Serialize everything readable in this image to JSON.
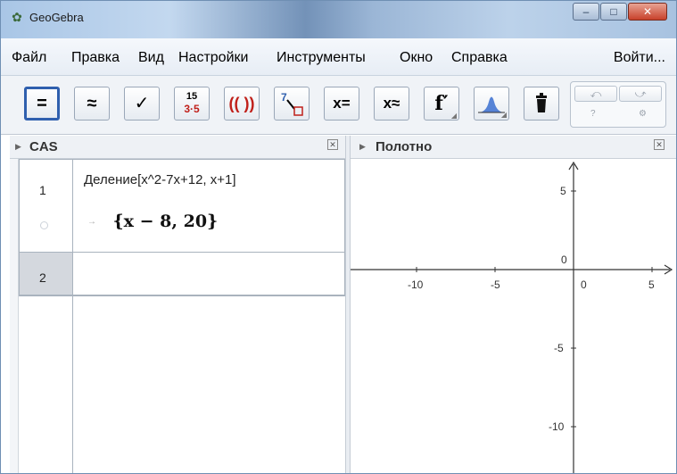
{
  "window": {
    "title": "GeoGebra",
    "buttons": {
      "minimize": "–",
      "maximize": "□",
      "close": "✕"
    }
  },
  "menu": {
    "items": [
      "Файл",
      "Правка",
      "Вид",
      "Настройки",
      "Инструменты",
      "Окно",
      "Справка"
    ],
    "login": "Войти..."
  },
  "toolbar": {
    "tools": [
      {
        "name": "evaluate",
        "label": "=",
        "active": true
      },
      {
        "name": "numeric",
        "label": "≈"
      },
      {
        "name": "keep-input",
        "label": "✓"
      },
      {
        "name": "factor",
        "label_top": "15",
        "label_bottom": "3·5"
      },
      {
        "name": "expand",
        "label": "(( ))"
      },
      {
        "name": "substitute",
        "label": "7"
      },
      {
        "name": "solve",
        "label": "x="
      },
      {
        "name": "solve-numerically",
        "label": "x≈"
      },
      {
        "name": "derivative",
        "label": "f′"
      },
      {
        "name": "probability",
        "label": ""
      },
      {
        "name": "delete",
        "label": ""
      }
    ]
  },
  "cas": {
    "title": "CAS",
    "rows": [
      {
        "number": "1",
        "input": "Деление[x^2-7x+12, x+1]",
        "output": "{x − 8, 20}"
      },
      {
        "number": "2",
        "input": "",
        "output": ""
      }
    ]
  },
  "graphics": {
    "title": "Полотно",
    "x_ticks": [
      "-10",
      "-5",
      "0",
      "5"
    ],
    "y_ticks": [
      "5",
      "0",
      "-5",
      "-10"
    ]
  },
  "colors": {
    "accent": "#2f5fae",
    "toolbar_bg": "#f0f3f7",
    "titlebar": "#a9c6e6"
  }
}
